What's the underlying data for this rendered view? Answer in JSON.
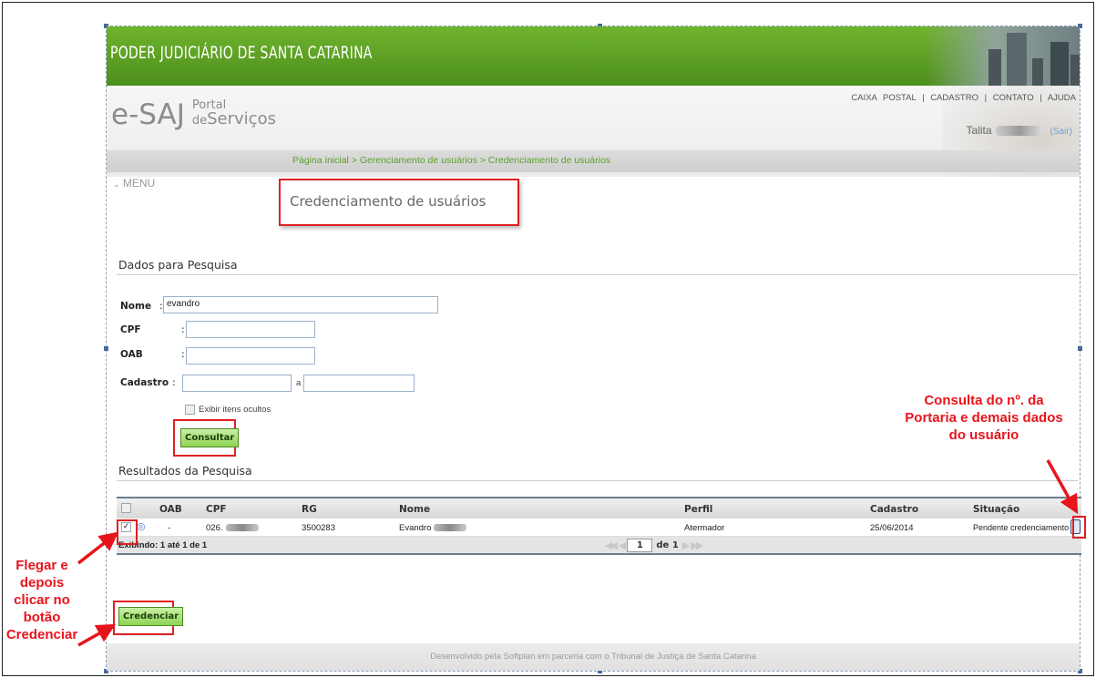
{
  "header": {
    "banner_title": "PODER JUDICIÁRIO DE SANTA CATARINA",
    "logo_main": "e-SAJ",
    "logo_portal": "Portal",
    "logo_de": "de",
    "logo_servicos": "Serviços",
    "links": [
      "CAIXA POSTAL",
      "CADASTRO",
      "CONTATO",
      "AJUDA"
    ],
    "user_name": "Talita",
    "logout": "(Sair)"
  },
  "breadcrumb": "Página inicial > Gerenciamento de usuários > Credenciamento de usuários",
  "menu_label": "MENU",
  "page_title": "Credenciamento de usuários",
  "search": {
    "section_title": "Dados para Pesquisa",
    "fields": {
      "nome_label": "Nome",
      "nome_value": "evandro",
      "cpf_label": "CPF",
      "oab_label": "OAB",
      "cadastro_label": "Cadastro",
      "cadastro_sep": "a",
      "colon": ":"
    },
    "checkbox_label": "Exibir itens ocultos",
    "consult_button": "Consultar"
  },
  "results": {
    "section_title": "Resultados da Pesquisa",
    "columns": [
      "OAB",
      "CPF",
      "RG",
      "Nome",
      "Perfil",
      "Cadastro",
      "Situação"
    ],
    "row": {
      "oab": "-",
      "cpf": "026.",
      "rg": "3500283",
      "nome": "Evandro",
      "perfil": "Atermador",
      "cadastro": "25/06/2014",
      "situacao": "Pendente credenciamento"
    },
    "footer_text": "Exibindo: 1 até 1 de 1",
    "page_current": "1",
    "page_of": "de 1"
  },
  "credenciar_button": "Credenciar",
  "footer": "Desenvolvido pela Softplan em parceria com o Tribunal de Justiça de Santa Catarina",
  "annotations": {
    "right": [
      "Consulta do nº. da",
      "Portaria e demais dados",
      "do usuário"
    ],
    "left": [
      "Flegar e",
      "depois",
      "clicar no",
      "botão",
      "Credenciar"
    ]
  },
  "colors": {
    "banner_green": "#5ea323",
    "annotation_red": "#e8141c",
    "link_green": "#5a9f2a"
  }
}
